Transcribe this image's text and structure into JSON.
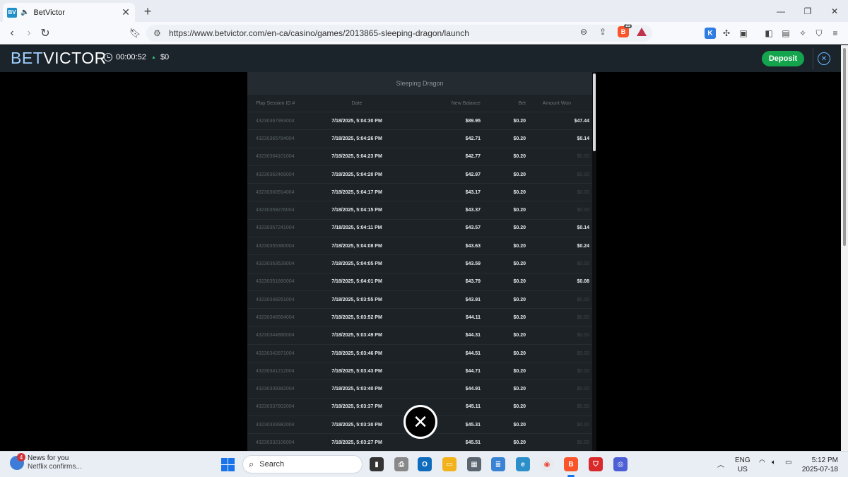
{
  "browser": {
    "tab": {
      "favicon_text": "BV",
      "title": "BetVictor",
      "close": "✕"
    },
    "new_tab": "+",
    "window_controls": [
      "—",
      "❐",
      "✕"
    ],
    "url": "https://www.betvictor.com/en-ca/casino/games/2013865-sleeping-dragon/launch",
    "shield_count": "23"
  },
  "site": {
    "logo_bet": "BET",
    "logo_victor": "VICTOR",
    "session_time": "00:00:52",
    "balance_change": "$0",
    "deposit_label": "Deposit"
  },
  "history": {
    "title": "Sleeping Dragon",
    "columns": [
      "Play Session ID #",
      "Date",
      "New Balance",
      "Bet",
      "Amount Won"
    ],
    "rows": [
      {
        "id": "43230367993004",
        "date": "7/18/2025, 5:04:30 PM",
        "balance": "$89.95",
        "bet": "$0.20",
        "won": "$47.44",
        "is_win": true
      },
      {
        "id": "43230365784004",
        "date": "7/18/2025, 5:04:26 PM",
        "balance": "$42.71",
        "bet": "$0.20",
        "won": "$0.14",
        "is_win": true
      },
      {
        "id": "43230364101004",
        "date": "7/18/2025, 5:04:23 PM",
        "balance": "$42.77",
        "bet": "$0.20",
        "won": "$0.00",
        "is_win": false
      },
      {
        "id": "43230362469004",
        "date": "7/18/2025, 5:04:20 PM",
        "balance": "$42.97",
        "bet": "$0.20",
        "won": "$0.00",
        "is_win": false
      },
      {
        "id": "43230360914004",
        "date": "7/18/2025, 5:04:17 PM",
        "balance": "$43.17",
        "bet": "$0.20",
        "won": "$0.00",
        "is_win": false
      },
      {
        "id": "43230359276004",
        "date": "7/18/2025, 5:04:15 PM",
        "balance": "$43.37",
        "bet": "$0.20",
        "won": "$0.00",
        "is_win": false
      },
      {
        "id": "43230357241004",
        "date": "7/18/2025, 5:04:11 PM",
        "balance": "$43.57",
        "bet": "$0.20",
        "won": "$0.14",
        "is_win": true
      },
      {
        "id": "43230355380004",
        "date": "7/18/2025, 5:04:08 PM",
        "balance": "$43.63",
        "bet": "$0.20",
        "won": "$0.24",
        "is_win": true
      },
      {
        "id": "43230353528004",
        "date": "7/18/2025, 5:04:05 PM",
        "balance": "$43.59",
        "bet": "$0.20",
        "won": "$0.00",
        "is_win": false
      },
      {
        "id": "43230351660004",
        "date": "7/18/2025, 5:04:01 PM",
        "balance": "$43.79",
        "bet": "$0.20",
        "won": "$0.08",
        "is_win": true
      },
      {
        "id": "43230348261004",
        "date": "7/18/2025, 5:03:55 PM",
        "balance": "$43.91",
        "bet": "$0.20",
        "won": "$0.00",
        "is_win": false
      },
      {
        "id": "43230346564004",
        "date": "7/18/2025, 5:03:52 PM",
        "balance": "$44.11",
        "bet": "$0.20",
        "won": "$0.00",
        "is_win": false
      },
      {
        "id": "43230344886004",
        "date": "7/18/2025, 5:03:49 PM",
        "balance": "$44.31",
        "bet": "$0.20",
        "won": "$0.00",
        "is_win": false
      },
      {
        "id": "43230342871004",
        "date": "7/18/2025, 5:03:46 PM",
        "balance": "$44.51",
        "bet": "$0.20",
        "won": "$0.00",
        "is_win": false
      },
      {
        "id": "43230341212004",
        "date": "7/18/2025, 5:03:43 PM",
        "balance": "$44.71",
        "bet": "$0.20",
        "won": "$0.00",
        "is_win": false
      },
      {
        "id": "43230339382004",
        "date": "7/18/2025, 5:03:40 PM",
        "balance": "$44.91",
        "bet": "$0.20",
        "won": "$0.00",
        "is_win": false
      },
      {
        "id": "43230337802004",
        "date": "7/18/2025, 5:03:37 PM",
        "balance": "$45.11",
        "bet": "$0.20",
        "won": "$0.00",
        "is_win": false
      },
      {
        "id": "43230333982004",
        "date": "7/18/2025, 5:03:30 PM",
        "balance": "$45.31",
        "bet": "$0.20",
        "won": "$0.00",
        "is_win": false
      },
      {
        "id": "43230332106004",
        "date": "7/18/2025, 5:03:27 PM",
        "balance": "$45.51",
        "bet": "$0.20",
        "won": "$0.00",
        "is_win": false
      }
    ]
  },
  "taskbar": {
    "news_badge": "4",
    "news_title": "News for you",
    "news_sub": "Netflix confirms...",
    "search_label": "Search",
    "lang_top": "ENG",
    "lang_bottom": "US",
    "time": "5:12 PM",
    "date": "2025-07-18"
  },
  "colors": {
    "deposit": "#14a44d",
    "header_bg": "#1b232b",
    "panel_bg": "#1c2226",
    "accent_blue": "#66b8ff"
  }
}
